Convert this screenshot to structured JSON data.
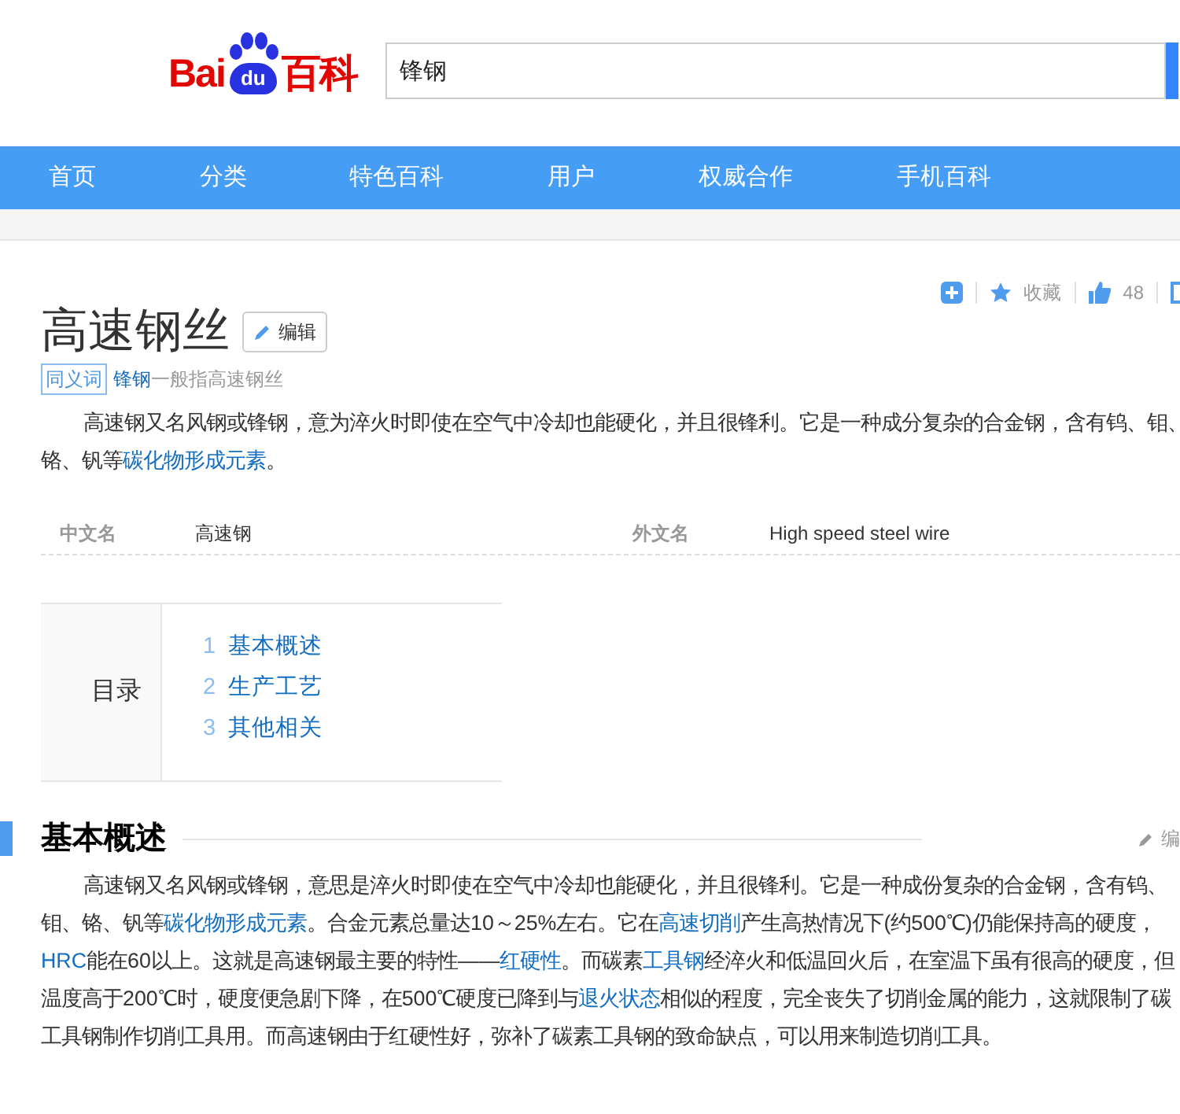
{
  "logo": {
    "text_1": "Bai",
    "paw_text": "du",
    "text_2": "百科"
  },
  "search": {
    "value": "锋钢"
  },
  "nav": [
    {
      "label": "首页"
    },
    {
      "label": "分类"
    },
    {
      "label": "特色百科"
    },
    {
      "label": "用户"
    },
    {
      "label": "权威合作"
    },
    {
      "label": "手机百科"
    }
  ],
  "toolbar": {
    "collect_label": "收藏",
    "like_count": "48"
  },
  "title": "高速钢丝",
  "edit_button": "编辑",
  "synonym": {
    "tag": "同义词",
    "link": "锋钢",
    "text": "一般指高速钢丝"
  },
  "summary": [
    [
      {
        "text": "高速钢又名风钢或锋钢，意为淬火时即使在空气中冷却也能硬化，并且很锋利。它是一种成分复杂的合金钢，含有钨、钼、",
        "link": false
      }
    ],
    [
      {
        "text": "铬、钒等",
        "link": false
      },
      {
        "text": "碳化物形成元素",
        "link": true
      },
      {
        "text": "。",
        "link": false
      }
    ]
  ],
  "basic_info": [
    {
      "label": "中文名",
      "value": "高速钢"
    },
    {
      "label": "外文名",
      "value": "High speed steel wire"
    }
  ],
  "toc": {
    "title": "目录",
    "items": [
      {
        "number": "1",
        "label": "基本概述"
      },
      {
        "number": "2",
        "label": "生产工艺"
      },
      {
        "number": "3",
        "label": "其他相关"
      }
    ]
  },
  "section": {
    "title": "基本概述",
    "edit": "编",
    "lines": [
      [
        {
          "text": "高速钢又名风钢或锋钢，意思是淬火时即使在空气中冷却也能硬化，并且很锋利。它是一种成份复杂的合金钢，含有钨、",
          "link": false
        }
      ],
      [
        {
          "text": "钼、铬、钒等",
          "link": false
        },
        {
          "text": "碳化物形成元素",
          "link": true
        },
        {
          "text": "。合金元素总量达10～25%左右。它在",
          "link": false
        },
        {
          "text": "高速切削",
          "link": true
        },
        {
          "text": "产生高热情况下(约500℃)仍能保持高的硬度，",
          "link": false
        }
      ],
      [
        {
          "text": "HRC",
          "link": true
        },
        {
          "text": "能在60以上。这就是高速钢最主要的特性——",
          "link": false
        },
        {
          "text": "红硬性",
          "link": true
        },
        {
          "text": "。而碳素",
          "link": false
        },
        {
          "text": "工具钢",
          "link": true
        },
        {
          "text": "经淬火和低温回火后，在室温下虽有很高的硬度，但",
          "link": false
        }
      ],
      [
        {
          "text": "温度高于200℃时，硬度便急剧下降，在500℃硬度已降到与",
          "link": false
        },
        {
          "text": "退火状态",
          "link": true
        },
        {
          "text": "相似的程度，完全丧失了切削金属的能力，这就限制了碳",
          "link": false
        }
      ],
      [
        {
          "text": "工具钢制作切削工具用。而高速钢由于红硬性好，弥补了碳素工具钢的致命缺点，可以用来制造切削工具。",
          "link": false
        }
      ]
    ]
  }
}
